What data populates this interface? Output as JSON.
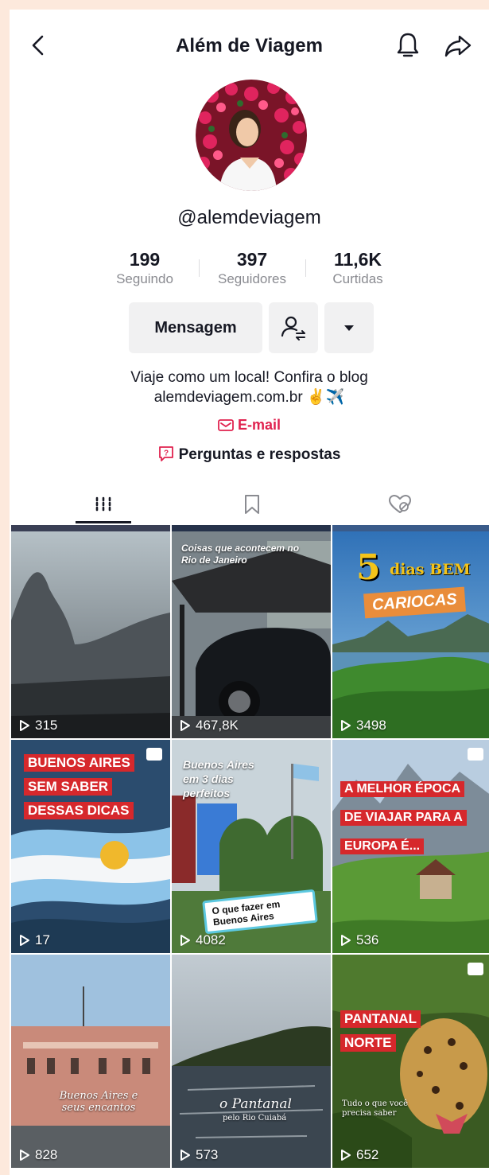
{
  "header": {
    "title": "Além de Viagem"
  },
  "profile": {
    "username": "@alemdeviagem",
    "stats": [
      {
        "value": "199",
        "label": "Seguindo"
      },
      {
        "value": "397",
        "label": "Seguidores"
      },
      {
        "value": "11,6K",
        "label": "Curtidas"
      }
    ],
    "message_button": "Mensagem",
    "bio_line1": "Viaje como um local! Confira o blog",
    "bio_line2": "alemdeviagem.com.br ✌️✈️",
    "email_label": "E-mail",
    "qa_label": "Perguntas e respostas"
  },
  "tabs": [
    {
      "icon": "grid-icon",
      "active": true
    },
    {
      "icon": "bookmark-icon",
      "active": false
    },
    {
      "icon": "liked-hidden-icon",
      "active": false
    }
  ],
  "videos": [
    {
      "views": "315"
    },
    {
      "views": "467,8K",
      "overlay": "Coisas que acontecem no Rio de Janeiro"
    },
    {
      "views": "3498",
      "overlay_num": "5",
      "overlay_text": "dias BEM",
      "overlay_sub": "CARIOCAS"
    },
    {
      "views": "17",
      "overlay_lines": [
        "BUENOS AIRES",
        "SEM SABER",
        "DESSAS DICAS"
      ]
    },
    {
      "views": "4082",
      "overlay_top": "Buenos Aires em 3 dias perfeitos",
      "overlay_sticker": "O que fazer em Buenos Aires"
    },
    {
      "views": "536",
      "overlay_lines": [
        "A MELHOR ÉPOCA",
        "DE VIAJAR PARA A",
        "EUROPA É..."
      ]
    },
    {
      "views": "828",
      "overlay": "Buenos Aires e seus encantos"
    },
    {
      "views": "573",
      "overlay": "o Pantanal",
      "overlay_sub": "pelo Rio Cuiabá"
    },
    {
      "views": "652",
      "overlay_lines": [
        "PANTANAL",
        "NORTE"
      ],
      "overlay_sub": "Tudo o que você precisa saber"
    }
  ],
  "colors": {
    "accent": "#e0224f",
    "page_bg": "#fde9dc"
  }
}
